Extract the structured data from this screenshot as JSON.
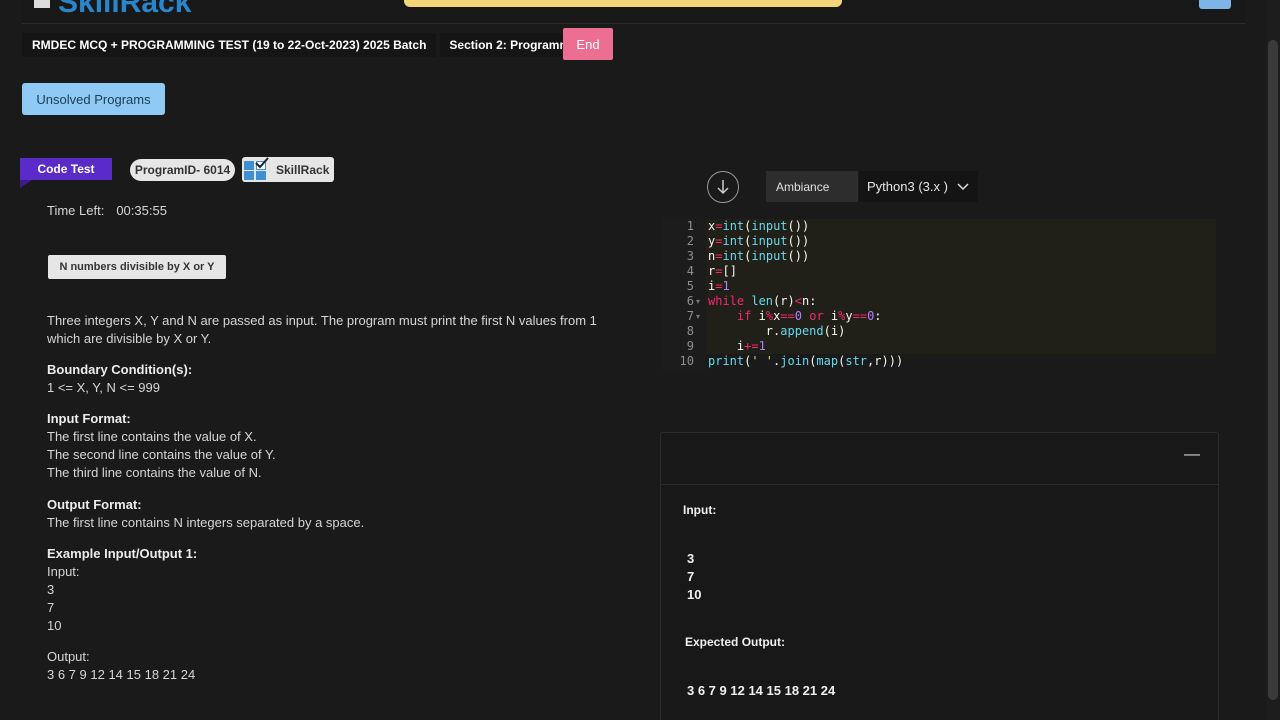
{
  "header": {
    "logo_text": "SkillRack",
    "test_name": "RMDEC MCQ + PROGRAMMING TEST (19 to 22-Oct-2023) 2025 Batch",
    "section": "Section 2: Programming",
    "end_label": "End"
  },
  "unsolved_label": "Unsolved Programs",
  "tags": {
    "code_test": "Code Test",
    "program_id": "ProgramID- 6014",
    "skillrack": "SkillRack"
  },
  "timer": {
    "label": "Time Left:",
    "value": "00:35:55"
  },
  "problem": {
    "title": "N numbers divisible by X or Y",
    "description_1": "Three integers X, Y and N are passed as input. The program must print the first N values from 1",
    "description_2": "which are divisible by X or Y.",
    "boundary_heading": "Boundary Condition(s):",
    "boundary": "1 <= X, Y, N <= 999",
    "input_heading": "Input Format:",
    "input_lines": [
      "The first line contains the value of X.",
      "The second line contains the value of Y.",
      "The third line contains the value of N."
    ],
    "output_heading": "Output Format:",
    "output_line": "The first line contains N integers separated by a space.",
    "example_heading": "Example Input/Output 1:",
    "example_input_label": "Input:",
    "example_input": [
      "3",
      "7",
      "10"
    ],
    "example_output_label": "Output:",
    "example_output": "3 6 7 9 12 14 15 18 21 24"
  },
  "editor": {
    "ambiance_label": "Ambiance",
    "language": "Python3 (3.x )",
    "line_numbers": [
      "1",
      "2",
      "3",
      "4",
      "5",
      "6",
      "7",
      "8",
      "9",
      "10"
    ],
    "code_lines": [
      "x=int(input())",
      "y=int(input())",
      "n=int(input())",
      "r=[]",
      "i=1",
      "while len(r)<n:",
      "    if i%x==0 or i%y==0:",
      "        r.append(i)",
      "    i+=1",
      "print(' '.join(map(str,r)))"
    ]
  },
  "output_panel": {
    "minimize_symbol": "—",
    "input_label": "Input:",
    "input_values": [
      "3",
      "7",
      "10"
    ],
    "expected_label": "Expected Output:",
    "expected_value": "3 6 7 9 12 14 15 18 21 24"
  },
  "colors": {
    "background": "#1a1a1a",
    "end_button": "#ec6f93",
    "unsolved_button": "#8ecaf3",
    "code_test_tag": "#5b2bc9",
    "editor_background": "#202018"
  }
}
